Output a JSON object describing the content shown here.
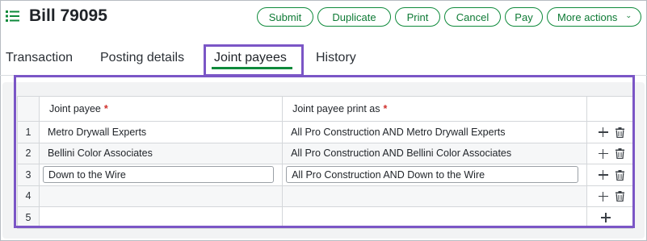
{
  "header": {
    "title": "Bill 79095",
    "actions": [
      {
        "label": "Submit"
      },
      {
        "label": "Duplicate"
      },
      {
        "label": "Print"
      },
      {
        "label": "Cancel"
      },
      {
        "label": "Pay"
      },
      {
        "label": "More actions"
      }
    ]
  },
  "tabs": [
    {
      "label": "Transaction"
    },
    {
      "label": "Posting details"
    },
    {
      "label": "Joint payees",
      "active": true
    },
    {
      "label": "History"
    }
  ],
  "grid": {
    "columns": [
      {
        "label": "Joint payee",
        "required": "*"
      },
      {
        "label": "Joint payee print as",
        "required": "*"
      }
    ],
    "rows": [
      {
        "num": "1",
        "payee": "Metro Drywall Experts",
        "print_as": "All Pro Construction AND Metro Drywall Experts"
      },
      {
        "num": "2",
        "payee": "Bellini Color Associates",
        "print_as": "All Pro Construction AND Bellini Color Associates"
      },
      {
        "num": "3",
        "payee": "Down to the Wire",
        "print_as": "All Pro Construction AND Down to the Wire"
      },
      {
        "num": "4",
        "payee": "",
        "print_as": ""
      },
      {
        "num": "5",
        "payee": "",
        "print_as": ""
      }
    ]
  },
  "colors": {
    "accent": "#0e8a3b",
    "highlight": "#7b56c6",
    "required": "#d0312d"
  }
}
